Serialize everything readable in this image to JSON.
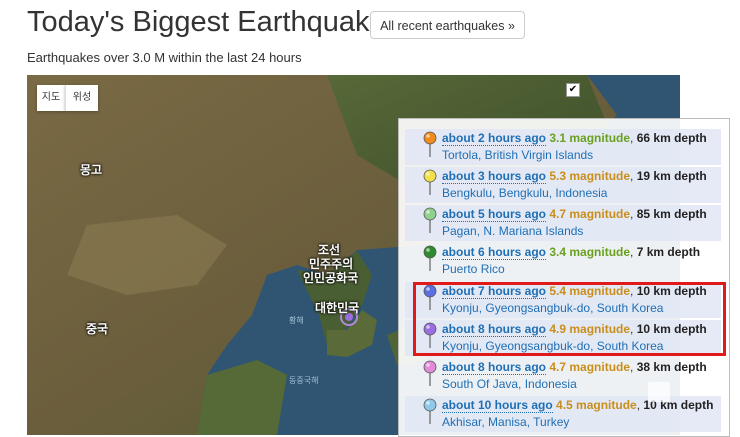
{
  "header": {
    "title": "Today's Biggest Earthquakes",
    "all_button": "All recent earthquakes »",
    "subtitle": "Earthquakes over 3.0 M within the last 24 hours"
  },
  "map": {
    "type_map": "지도",
    "type_satellite": "위성",
    "checkbox": "✔",
    "labels": {
      "mongolia": "몽고",
      "china": "중국",
      "nk1": "조선",
      "nk2": "민주주의",
      "nk3": "인민공화국",
      "sk": "대한민국",
      "yellow_sea": "황해",
      "east_china_sea": "동중국해"
    }
  },
  "quakes": [
    {
      "time": "about 2 hours ago",
      "mag": "3.1 magnitude",
      "sep": ", ",
      "depth": "66 km depth",
      "place": "Tortola, British Virgin Islands",
      "pin_color": "#f08a1c",
      "mag_color": "#6aa01f",
      "shade": true
    },
    {
      "time": "about 3 hours ago",
      "mag": "5.3 magnitude",
      "sep": ", ",
      "depth": "19 km depth",
      "place": "Bengkulu, Bengkulu, Indonesia",
      "pin_color": "#f2e04a",
      "mag_color": "#c98e1b",
      "shade": true
    },
    {
      "time": "about 5 hours ago",
      "mag": "4.7 magnitude",
      "sep": ", ",
      "depth": "85 km depth",
      "place": "Pagan, N. Mariana Islands",
      "pin_color": "#8fd18a",
      "mag_color": "#c98e1b",
      "shade": true
    },
    {
      "time": "about 6 hours ago",
      "mag": "3.4 magnitude",
      "sep": ", ",
      "depth": "7 km depth",
      "place": "Puerto Rico",
      "pin_color": "#2e8b2e",
      "mag_color": "#6aa01f",
      "shade": false
    },
    {
      "time": "about 7 hours ago",
      "mag": "5.4 magnitude",
      "sep": ", ",
      "depth": "10 km depth",
      "place": "Kyonju, Gyeongsangbuk-do, South Korea",
      "pin_color": "#5b6fe0",
      "mag_color": "#c98e1b",
      "shade": true
    },
    {
      "time": "about 8 hours ago",
      "mag": "4.9 magnitude",
      "sep": ", ",
      "depth": "10 km depth",
      "place": "Kyonju, Gyeongsangbuk-do, South Korea",
      "pin_color": "#9b6fe0",
      "mag_color": "#c98e1b",
      "shade": true
    },
    {
      "time": "about 8 hours ago",
      "mag": "4.7 magnitude",
      "sep": ", ",
      "depth": "38 km depth",
      "place": "South Of Java, Indonesia",
      "pin_color": "#e08ad8",
      "mag_color": "#c98e1b",
      "shade": false
    },
    {
      "time": "about 10 hours ago",
      "mag": "4.5 magnitude",
      "sep": ", ",
      "depth": "10 km depth",
      "place": "Akhisar, Manisa, Turkey",
      "pin_color": "#8fc8e8",
      "mag_color": "#c98e1b",
      "shade": true
    }
  ]
}
